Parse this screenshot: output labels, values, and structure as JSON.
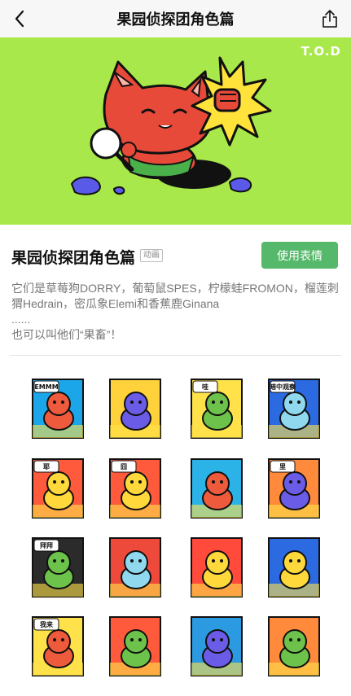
{
  "header": {
    "title": "果园侦探团角色篇"
  },
  "banner": {
    "brand": "T.O.D",
    "background": "#a8e84a"
  },
  "pack": {
    "title": "果园侦探团角色篇",
    "tag": "动画",
    "use_button": "使用表情",
    "description_lines": [
      "它们是草莓狗DORRY，葡萄鼠SPES，柠檬蛙FROMON，榴莲刺猬Hedrain，密瓜象Elemi和香蕉鹿Ginana",
      "......",
      "也可以叫他们“果畜”！"
    ]
  },
  "stickers": [
    {
      "icon": "strawberry-dog-sticker",
      "caption": "EMMM",
      "bg": "#1aa6e8",
      "char": "#ee5a3c"
    },
    {
      "icon": "grape-mouse-sticker",
      "caption": "",
      "bg": "#ffd23c",
      "char": "#6b5ce8"
    },
    {
      "icon": "lemon-frog-sticker",
      "caption": "哇",
      "bg": "#ffe24a",
      "char": "#6cc24a"
    },
    {
      "icon": "melon-elephant-sticker",
      "caption": "暗中观察",
      "bg": "#2b6ae0",
      "char": "#8fd8ee"
    },
    {
      "icon": "banana-deer-sticker",
      "caption": "耶",
      "bg": "#ff5a3c",
      "char": "#ffd93c"
    },
    {
      "icon": "banana-deer-sticker",
      "caption": "囧",
      "bg": "#ff5a3c",
      "char": "#ffd93c"
    },
    {
      "icon": "strawberry-dog-sticker",
      "caption": "",
      "bg": "#2bb3e8",
      "char": "#ee5a3c"
    },
    {
      "icon": "grape-mouse-sticker",
      "caption": "里",
      "bg": "#ff8a3c",
      "char": "#6b5ce8"
    },
    {
      "icon": "lemon-frog-sticker",
      "caption": "拜拜",
      "bg": "#2b2b2b",
      "char": "#6cc24a"
    },
    {
      "icon": "melon-elephant-sticker",
      "caption": "",
      "bg": "#ee4a3c",
      "char": "#8fd8ee"
    },
    {
      "icon": "durian-hedgehog-sticker",
      "caption": "",
      "bg": "#ff4a3c",
      "char": "#ffd93c"
    },
    {
      "icon": "banana-deer-sticker",
      "caption": "",
      "bg": "#2b6ae0",
      "char": "#ffd93c"
    },
    {
      "icon": "strawberry-dog-sticker",
      "caption": "我来",
      "bg": "#ffe24a",
      "char": "#ee5a3c"
    },
    {
      "icon": "lemon-frog-sticker",
      "caption": "",
      "bg": "#ff5a3c",
      "char": "#6cc24a"
    },
    {
      "icon": "grape-mouse-sticker",
      "caption": "",
      "bg": "#2b9ae0",
      "char": "#6b5ce8"
    },
    {
      "icon": "lemon-frog-sticker",
      "caption": "",
      "bg": "#ff8a3c",
      "char": "#6cc24a"
    }
  ]
}
